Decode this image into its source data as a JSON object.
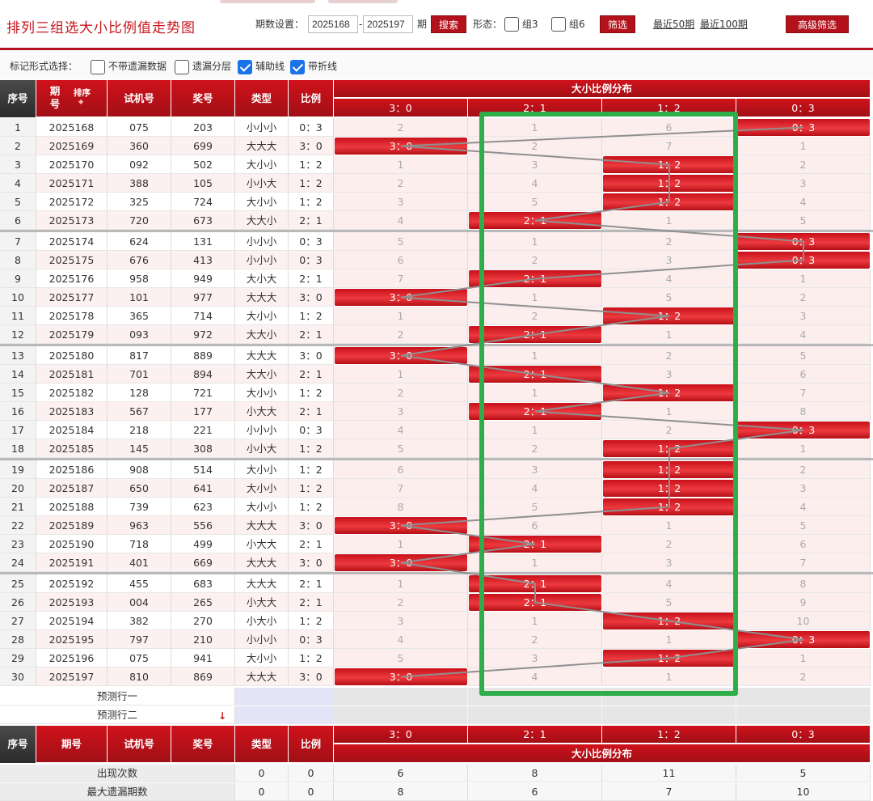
{
  "page": {
    "title": "排列三组选大小比例值走势图",
    "period_label": "期数设置：",
    "period_from": "2025168",
    "period_to": "2025197",
    "period_sep": "-",
    "period_unit": "期",
    "search_label": "搜索",
    "form_label": "形态：",
    "group3_label": "组3",
    "group6_label": "组6",
    "filter_label": "筛选",
    "recent50": "最近50期",
    "recent100": "最近100期",
    "advanced_label": "高级筛选"
  },
  "options": {
    "label": "标记形式选择：",
    "items": [
      {
        "label": "不带遗漏数据",
        "checked": false
      },
      {
        "label": "遗漏分层",
        "checked": false
      },
      {
        "label": "辅助线",
        "checked": true
      },
      {
        "label": "带折线",
        "checked": true
      }
    ]
  },
  "table": {
    "headers": {
      "seq": "序号",
      "period": "期号",
      "sort": "排序",
      "trial": "试机号",
      "prize": "奖号",
      "type": "类型",
      "ratio": "比例",
      "dist": "大小比例分布"
    },
    "ratio_cols": [
      "3：0",
      "2：1",
      "1：2",
      "0：3"
    ],
    "rows": [
      {
        "n": "1",
        "p": "2025168",
        "t": "075",
        "z": "203",
        "k": "小小小",
        "r": "0：3",
        "hit": 3,
        "m": [
          "2",
          "1",
          "6",
          ""
        ]
      },
      {
        "n": "2",
        "p": "2025169",
        "t": "360",
        "z": "699",
        "k": "大大大",
        "r": "3：0",
        "hit": 0,
        "m": [
          "",
          "2",
          "7",
          "1"
        ]
      },
      {
        "n": "3",
        "p": "2025170",
        "t": "092",
        "z": "502",
        "k": "大小小",
        "r": "1：2",
        "hit": 2,
        "m": [
          "1",
          "3",
          "",
          "2"
        ]
      },
      {
        "n": "4",
        "p": "2025171",
        "t": "388",
        "z": "105",
        "k": "小小大",
        "r": "1：2",
        "hit": 2,
        "m": [
          "2",
          "4",
          "",
          "3"
        ]
      },
      {
        "n": "5",
        "p": "2025172",
        "t": "325",
        "z": "724",
        "k": "大小小",
        "r": "1：2",
        "hit": 2,
        "m": [
          "3",
          "5",
          "",
          "4"
        ]
      },
      {
        "n": "6",
        "p": "2025173",
        "t": "720",
        "z": "673",
        "k": "大大小",
        "r": "2：1",
        "hit": 1,
        "m": [
          "4",
          "",
          "1",
          "5"
        ]
      },
      {
        "n": "7",
        "p": "2025174",
        "t": "624",
        "z": "131",
        "k": "小小小",
        "r": "0：3",
        "hit": 3,
        "m": [
          "5",
          "1",
          "2",
          ""
        ]
      },
      {
        "n": "8",
        "p": "2025175",
        "t": "676",
        "z": "413",
        "k": "小小小",
        "r": "0：3",
        "hit": 3,
        "m": [
          "6",
          "2",
          "3",
          ""
        ]
      },
      {
        "n": "9",
        "p": "2025176",
        "t": "958",
        "z": "949",
        "k": "大小大",
        "r": "2：1",
        "hit": 1,
        "m": [
          "7",
          "",
          "4",
          "1"
        ]
      },
      {
        "n": "10",
        "p": "2025177",
        "t": "101",
        "z": "977",
        "k": "大大大",
        "r": "3：0",
        "hit": 0,
        "m": [
          "",
          "1",
          "5",
          "2"
        ]
      },
      {
        "n": "11",
        "p": "2025178",
        "t": "365",
        "z": "714",
        "k": "大小小",
        "r": "1：2",
        "hit": 2,
        "m": [
          "1",
          "2",
          "",
          "3"
        ]
      },
      {
        "n": "12",
        "p": "2025179",
        "t": "093",
        "z": "972",
        "k": "大大小",
        "r": "2：1",
        "hit": 1,
        "m": [
          "2",
          "",
          "1",
          "4"
        ]
      },
      {
        "n": "13",
        "p": "2025180",
        "t": "817",
        "z": "889",
        "k": "大大大",
        "r": "3：0",
        "hit": 0,
        "m": [
          "",
          "1",
          "2",
          "5"
        ]
      },
      {
        "n": "14",
        "p": "2025181",
        "t": "701",
        "z": "894",
        "k": "大大小",
        "r": "2：1",
        "hit": 1,
        "m": [
          "1",
          "",
          "3",
          "6"
        ]
      },
      {
        "n": "15",
        "p": "2025182",
        "t": "128",
        "z": "721",
        "k": "大小小",
        "r": "1：2",
        "hit": 2,
        "m": [
          "2",
          "1",
          "",
          "7"
        ]
      },
      {
        "n": "16",
        "p": "2025183",
        "t": "567",
        "z": "177",
        "k": "小大大",
        "r": "2：1",
        "hit": 1,
        "m": [
          "3",
          "",
          "1",
          "8"
        ]
      },
      {
        "n": "17",
        "p": "2025184",
        "t": "218",
        "z": "221",
        "k": "小小小",
        "r": "0：3",
        "hit": 3,
        "m": [
          "4",
          "1",
          "2",
          ""
        ]
      },
      {
        "n": "18",
        "p": "2025185",
        "t": "145",
        "z": "308",
        "k": "小小大",
        "r": "1：2",
        "hit": 2,
        "m": [
          "5",
          "2",
          "",
          "1"
        ]
      },
      {
        "n": "19",
        "p": "2025186",
        "t": "908",
        "z": "514",
        "k": "大小小",
        "r": "1：2",
        "hit": 2,
        "m": [
          "6",
          "3",
          "",
          "2"
        ]
      },
      {
        "n": "20",
        "p": "2025187",
        "t": "650",
        "z": "641",
        "k": "大小小",
        "r": "1：2",
        "hit": 2,
        "m": [
          "7",
          "4",
          "",
          "3"
        ]
      },
      {
        "n": "21",
        "p": "2025188",
        "t": "739",
        "z": "623",
        "k": "大小小",
        "r": "1：2",
        "hit": 2,
        "m": [
          "8",
          "5",
          "",
          "4"
        ]
      },
      {
        "n": "22",
        "p": "2025189",
        "t": "963",
        "z": "556",
        "k": "大大大",
        "r": "3：0",
        "hit": 0,
        "m": [
          "",
          "6",
          "1",
          "5"
        ]
      },
      {
        "n": "23",
        "p": "2025190",
        "t": "718",
        "z": "499",
        "k": "小大大",
        "r": "2：1",
        "hit": 1,
        "m": [
          "1",
          "",
          "2",
          "6"
        ]
      },
      {
        "n": "24",
        "p": "2025191",
        "t": "401",
        "z": "669",
        "k": "大大大",
        "r": "3：0",
        "hit": 0,
        "m": [
          "",
          "1",
          "3",
          "7"
        ]
      },
      {
        "n": "25",
        "p": "2025192",
        "t": "455",
        "z": "683",
        "k": "大大大",
        "r": "2：1",
        "hit": 1,
        "m": [
          "1",
          "",
          "4",
          "8"
        ]
      },
      {
        "n": "26",
        "p": "2025193",
        "t": "004",
        "z": "265",
        "k": "小大大",
        "r": "2：1",
        "hit": 1,
        "m": [
          "2",
          "",
          "5",
          "9"
        ]
      },
      {
        "n": "27",
        "p": "2025194",
        "t": "382",
        "z": "270",
        "k": "小大小",
        "r": "1：2",
        "hit": 2,
        "m": [
          "3",
          "1",
          "",
          "10"
        ]
      },
      {
        "n": "28",
        "p": "2025195",
        "t": "797",
        "z": "210",
        "k": "小小小",
        "r": "0：3",
        "hit": 3,
        "m": [
          "4",
          "2",
          "1",
          ""
        ]
      },
      {
        "n": "29",
        "p": "2025196",
        "t": "075",
        "z": "941",
        "k": "大小小",
        "r": "1：2",
        "hit": 2,
        "m": [
          "5",
          "3",
          "",
          "1"
        ]
      },
      {
        "n": "30",
        "p": "2025197",
        "t": "810",
        "z": "869",
        "k": "大大大",
        "r": "3：0",
        "hit": 0,
        "m": [
          "",
          "4",
          "1",
          "2"
        ]
      }
    ],
    "predict1": "预测行一",
    "predict2": "预测行二",
    "stats": [
      {
        "label": "出现次数",
        "type": "0",
        "ratio": "0",
        "vals": [
          "6",
          "8",
          "11",
          "5"
        ]
      },
      {
        "label": "最大遗漏期数",
        "type": "0",
        "ratio": "0",
        "vals": [
          "8",
          "6",
          "7",
          "10"
        ]
      }
    ]
  }
}
